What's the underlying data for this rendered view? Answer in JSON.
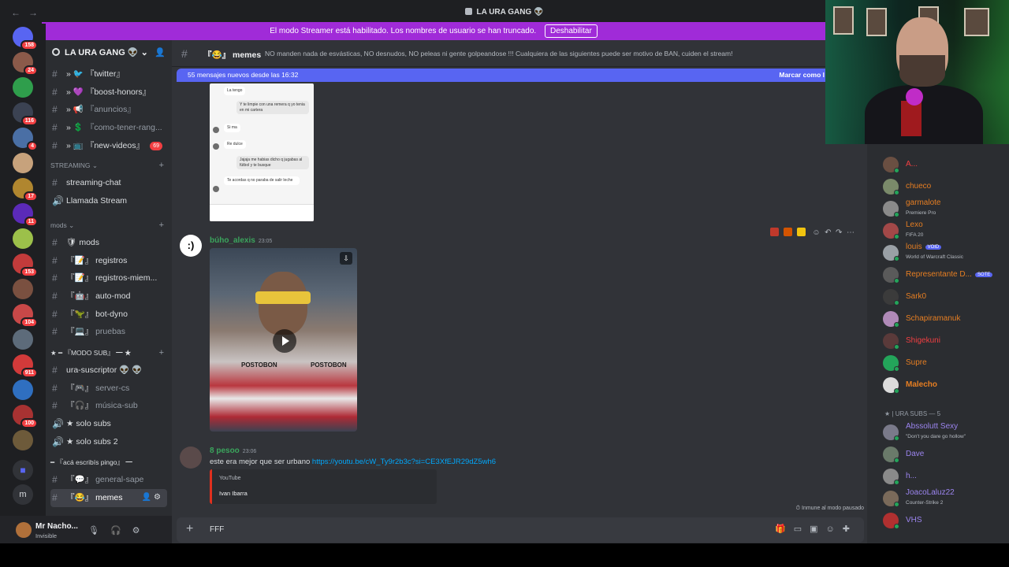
{
  "window": {
    "title": "LA URA GANG 👽",
    "nav_back": "←",
    "nav_forward": "→"
  },
  "banner": {
    "text": "El modo Streamer está habilitado. Los nombres de usuario se han truncado.",
    "button": "Deshabilitar"
  },
  "servers": [
    {
      "badge": "158",
      "color": "#3a3a3a"
    },
    {
      "badge": "24",
      "color": "#8b5a4a"
    },
    {
      "badge": "",
      "color": "#2f9e4c"
    },
    {
      "badge": "116",
      "color": "#3b4252"
    },
    {
      "badge": "4",
      "color": "#4a6fa5"
    },
    {
      "badge": "",
      "color": "#c7a27c"
    },
    {
      "badge": "17",
      "color": "#b0862f"
    },
    {
      "badge": "11",
      "color": "#5b2ab8"
    },
    {
      "badge": "",
      "color": "#9cc04a"
    },
    {
      "badge": "153",
      "color": "#c23b3b"
    },
    {
      "badge": "",
      "color": "#7a5040"
    },
    {
      "badge": "104",
      "color": "#c84848"
    },
    {
      "badge": "",
      "color": "#5d6b7a"
    },
    {
      "badge": "911",
      "color": "#d23a3a"
    },
    {
      "badge": "",
      "color": "#2f6fc0"
    },
    {
      "badge": "100",
      "color": "#a83232"
    },
    {
      "badge": "",
      "color": "#6d5a3a"
    }
  ],
  "sidebar": {
    "guild_name": "LA URA GANG 👽",
    "channels_top": [
      {
        "name": "『twitter』",
        "prefix": "» 🐦",
        "badge": ""
      },
      {
        "name": "『boost-honors』",
        "prefix": "» 💜",
        "badge": ""
      },
      {
        "name": "『anuncios』",
        "prefix": "» 📢",
        "badge": "",
        "muted": true
      },
      {
        "name": "『como-tener-rang...",
        "prefix": "» 💲",
        "badge": "",
        "muted": true
      },
      {
        "name": "『new-videos』",
        "prefix": "» 📺",
        "badge": "69"
      }
    ],
    "cat_streaming": "STREAMING",
    "channels_streaming": [
      {
        "name": "streaming-chat",
        "icon": "#"
      },
      {
        "name": "Llamada Stream",
        "icon": "🔊"
      }
    ],
    "cat_mods": "mods",
    "channels_mods": [
      {
        "name": "mods",
        "prefix": "🛡",
        "icon": "#"
      },
      {
        "name": "registros",
        "prefix": "『📝』",
        "icon": "#"
      },
      {
        "name": "registros-miem...",
        "prefix": "『📝』",
        "icon": "#"
      },
      {
        "name": "auto-mod",
        "prefix": "『🤖』",
        "icon": "#"
      },
      {
        "name": "bot-dyno",
        "prefix": "『🦖』",
        "icon": "#"
      },
      {
        "name": "pruebas",
        "prefix": "『💻』",
        "icon": "#",
        "muted": true
      }
    ],
    "cat_modosub": "★ ━ 『MODO SUB』 ━ ★",
    "channels_sub": [
      {
        "name": "ura-suscriptor 👽 👽",
        "icon": "#"
      },
      {
        "name": "server-cs",
        "prefix": "『🎮』",
        "icon": "#",
        "muted": true
      },
      {
        "name": "música-sub",
        "prefix": "『🎧』",
        "icon": "#",
        "muted": true
      },
      {
        "name": "solo subs",
        "prefix": "★",
        "icon": "🔊"
      },
      {
        "name": "solo subs 2",
        "prefix": "★",
        "icon": "🔊"
      }
    ],
    "cat_aca": "━ 『acá escribís pingo』 ━",
    "channels_aca": [
      {
        "name": "general-sape",
        "prefix": "『💬』",
        "icon": "#",
        "muted": true
      },
      {
        "name": "memes",
        "prefix": "『😂』",
        "icon": "#",
        "active": true
      }
    ]
  },
  "user": {
    "name": "Mr Nacho...",
    "status": "Invisible"
  },
  "chat": {
    "channel_name": "『😂』 memes",
    "topic": "NO manden nada de esvásticas, NO desnudos, NO peleas ni gente golpeandose !!! Cualquiera de las siguientes puede ser motivo de BAN, cuiden el stream!",
    "new_messages": "55 mensajes nuevos desde las 16:32",
    "mark_read": "Marcar como l",
    "screenshot_bubbles": [
      "La tengo",
      "Y te limpie con una remera q yo tenia en mi cartera",
      "Si ma",
      "Re dulce",
      "Jajaja me habias dicho q jugabas al fútbol y te busque",
      "Te acordas q no paraba de salir leche"
    ],
    "msg1": {
      "author": "búho_alexis",
      "time": "23:05",
      "author_color": "#3ba55d"
    },
    "video_sponsor": "POSTOBON",
    "msg2": {
      "author": "8 pesoo",
      "time": "23:06",
      "author_color": "#3ba55d",
      "text": "este era mejor que ser urbano",
      "link": "https://youtu.be/cW_Ty9r2b3c?si=CE3XfEJR29dZ5wh6",
      "embed_provider": "YouTube",
      "embed_author": "Ivan Ibarra"
    },
    "immune": "Inmune al modo pausado",
    "composer_text": "FFF"
  },
  "members": [
    {
      "name": "A...",
      "color": "#f23f42",
      "activity": "",
      "av": "#6a4f42"
    },
    {
      "name": "chueco",
      "color": "#e67e22",
      "activity": "",
      "av": "#7a8a6a"
    },
    {
      "name": "garmalote",
      "color": "#e67e22",
      "activity": "Premiere Pro",
      "av": "#8a8a8a"
    },
    {
      "name": "Lexo",
      "color": "#e67e22",
      "activity": "FIFA 20",
      "av": "#a24848"
    },
    {
      "name": "louis",
      "color": "#e67e22",
      "activity": "World of Warcraft Classic",
      "av": "#9aa0a6",
      "tag": "VOID"
    },
    {
      "name": "Representante D...",
      "color": "#e67e22",
      "activity": "",
      "av": "#5a5a5a",
      "tag": "SOTE"
    },
    {
      "name": "Sark0",
      "color": "#e67e22",
      "activity": "",
      "av": "#3b3b3b"
    },
    {
      "name": "Schapiramanuk",
      "color": "#e67e22",
      "activity": "",
      "av": "#b08ab8"
    },
    {
      "name": "Shigekuni",
      "color": "#f23f42",
      "activity": "",
      "av": "#5a3a3a"
    },
    {
      "name": "Supre",
      "color": "#e67e22",
      "activity": "",
      "av": "#23a55a"
    },
    {
      "name": "Malecho",
      "color": "#e67e22",
      "activity": "",
      "av": "#dcdcdc",
      "bold": true
    }
  ],
  "members_cat": "★ | URA SUBS — 5",
  "subs": [
    {
      "name": "Abssolutt Sexy",
      "color": "#9b84ee",
      "activity": "\"Don't you dare go hollow\"",
      "av": "#7a7a8a"
    },
    {
      "name": "Dave",
      "color": "#9b84ee",
      "activity": "",
      "av": "#6a7a6a"
    },
    {
      "name": "h...",
      "color": "#9b84ee",
      "activity": "",
      "av": "#8a8a8a"
    },
    {
      "name": "JoacoLaluz22",
      "color": "#9b84ee",
      "activity": "Counter-Strike 2",
      "av": "#7a6a5a"
    },
    {
      "name": "VHS",
      "color": "#9b84ee",
      "activity": "",
      "av": "#b03030"
    }
  ],
  "colors": {
    "accent": "#5865f2",
    "banner": "#a02bd8",
    "danger": "#f23f42",
    "link": "#00a8fc"
  }
}
